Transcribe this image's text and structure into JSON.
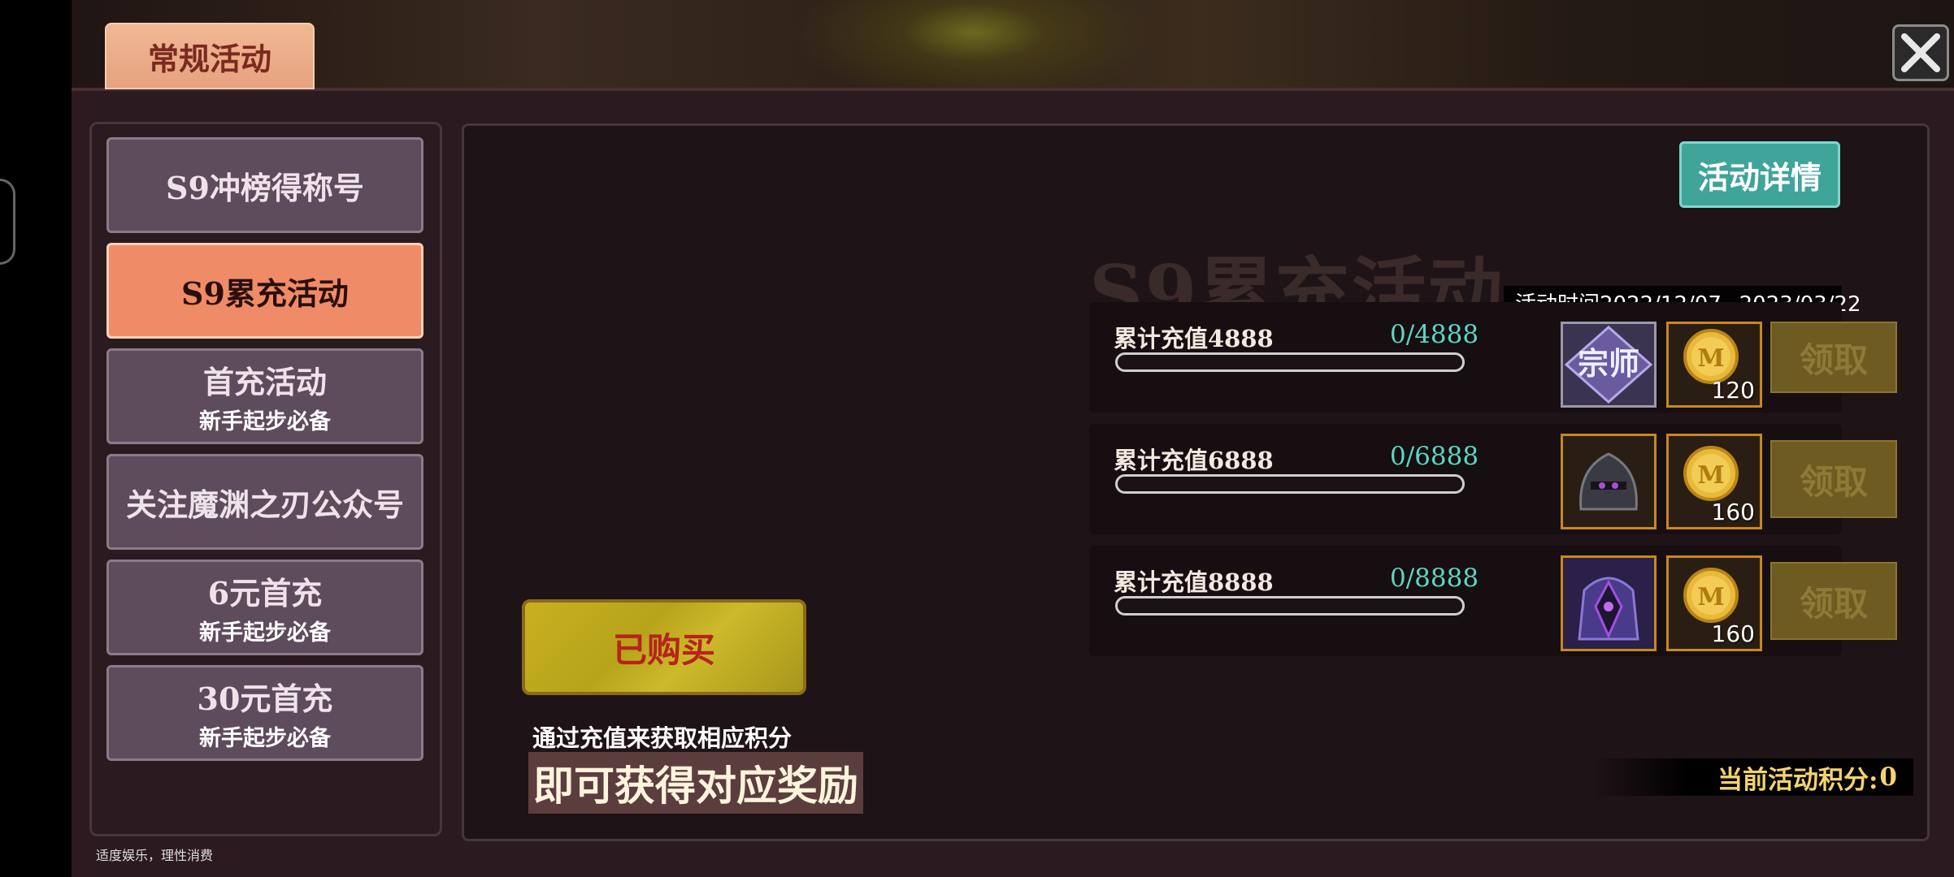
{
  "header": {
    "tab_title": "常规活动",
    "close_icon": "close-icon"
  },
  "sidebar": {
    "items": [
      {
        "label": "S9冲榜得称号",
        "sub": ""
      },
      {
        "label": "S9累充活动",
        "sub": "",
        "active": true
      },
      {
        "label": "首充活动",
        "sub": "新手起步必备"
      },
      {
        "label": "关注魔渊之刃公众号",
        "sub": ""
      },
      {
        "label": "6元首充",
        "sub": "新手起步必备"
      },
      {
        "label": "30元首充",
        "sub": "新手起步必备"
      }
    ],
    "disclaimer": "适度娱乐，理性消费"
  },
  "main": {
    "detail_button": "活动详情",
    "activity_title": "S9累充活动",
    "activity_time": "活动时间2022/12/07~2023/03/22",
    "bought_button": "已购买",
    "hint_small": "通过充值来获取相应积分",
    "hint_big": "即可获得对应奖励",
    "points_label": "当前活动积分:",
    "points_value": "0",
    "rewards": [
      {
        "label": "累计充值4888",
        "progress": "0/4888",
        "progress_fraction": 0,
        "item1_icon": "master-title-icon",
        "item1_text": "宗师",
        "item2_icon": "m-coin-icon",
        "item2_count": "120",
        "claim": "领取"
      },
      {
        "label": "累计充值6888",
        "progress": "0/6888",
        "progress_fraction": 0,
        "item1_icon": "dark-helmet-icon",
        "item2_icon": "m-coin-icon",
        "item2_count": "160",
        "claim": "领取"
      },
      {
        "label": "累计充值8888",
        "progress": "0/8888",
        "progress_fraction": 0,
        "item1_icon": "armor-costume-icon",
        "item2_icon": "m-coin-icon",
        "item2_count": "160",
        "claim": "领取"
      }
    ]
  },
  "colors": {
    "accent_active": "#f08b68",
    "progress_text": "#5cd6c6",
    "points_text": "#f5d36c",
    "detail_button": "#3fa49a"
  }
}
